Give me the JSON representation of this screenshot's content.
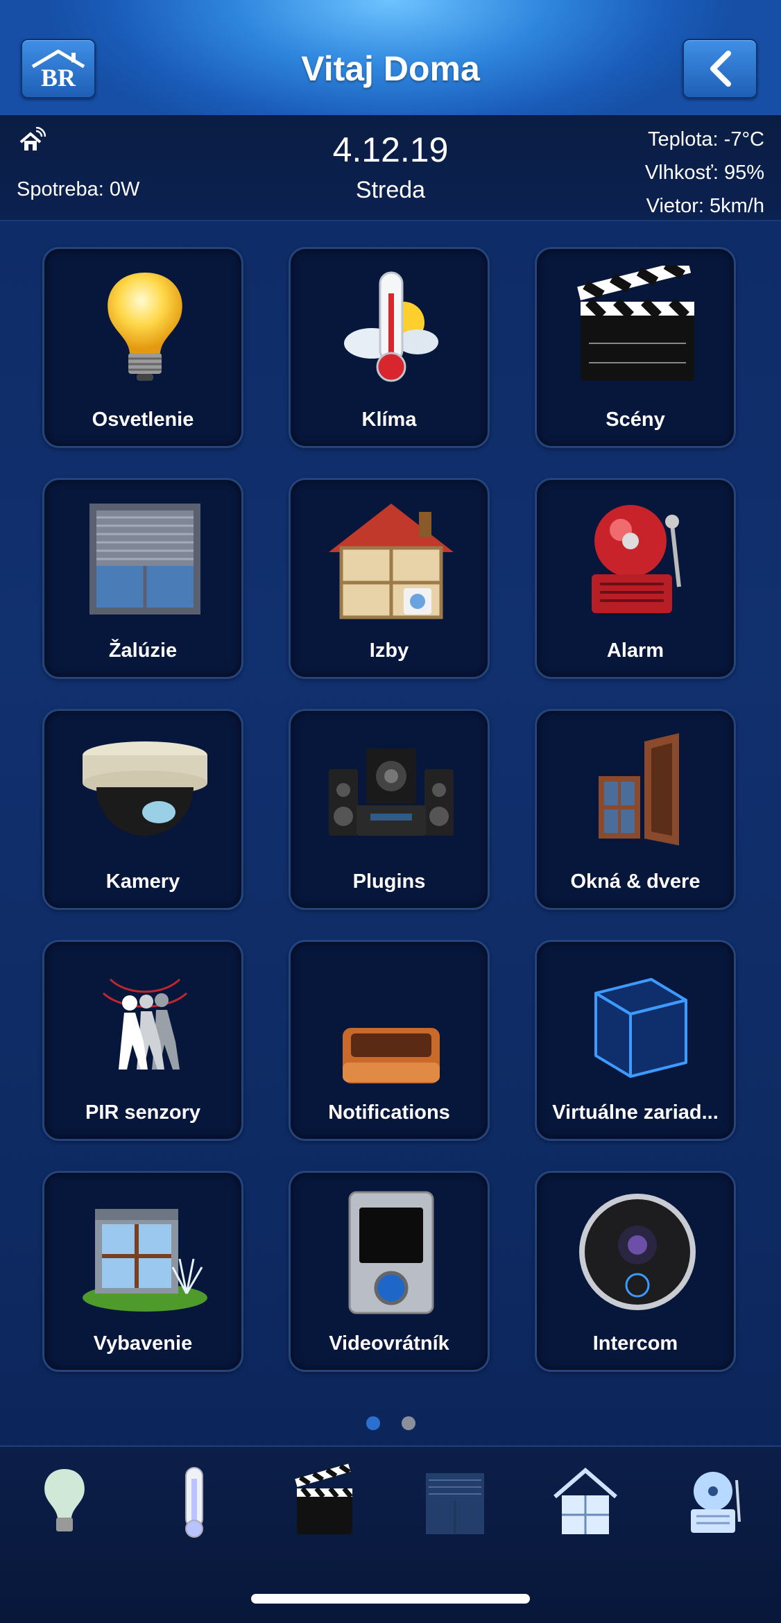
{
  "header": {
    "title": "Vitaj Doma",
    "logo_text": "BR"
  },
  "info": {
    "spotreba": "Spotreba: 0W",
    "date": "4.12.19",
    "day": "Streda",
    "teplota": "Teplota: -7°C",
    "vlhkost": "Vlhkosť: 95%",
    "vietor": "Vietor: 5km/h"
  },
  "tiles": [
    {
      "label": "Osvetlenie",
      "icon": "light-bulb-icon"
    },
    {
      "label": "Klíma",
      "icon": "thermometer-icon"
    },
    {
      "label": "Scény",
      "icon": "clapperboard-icon"
    },
    {
      "label": "Žalúzie",
      "icon": "roller-blind-icon"
    },
    {
      "label": "Izby",
      "icon": "house-rooms-icon"
    },
    {
      "label": "Alarm",
      "icon": "alarm-bell-icon"
    },
    {
      "label": "Kamery",
      "icon": "dome-camera-icon"
    },
    {
      "label": "Plugins",
      "icon": "stereo-icon"
    },
    {
      "label": "Okná & dvere",
      "icon": "window-door-icon"
    },
    {
      "label": "PIR senzory",
      "icon": "motion-sensor-icon"
    },
    {
      "label": "Notifications",
      "icon": "inbox-tray-icon"
    },
    {
      "label": "Virtuálne zariad...",
      "icon": "virtual-cube-icon"
    },
    {
      "label": "Vybavenie",
      "icon": "garden-window-icon"
    },
    {
      "label": "Videovrátník",
      "icon": "video-intercom-icon"
    },
    {
      "label": "Intercom",
      "icon": "intercom-camera-icon"
    }
  ],
  "pager": {
    "pages": 2,
    "current": 1
  },
  "tabbar": [
    {
      "icon": "light-bulb-icon"
    },
    {
      "icon": "thermometer-icon"
    },
    {
      "icon": "clapperboard-icon"
    },
    {
      "icon": "roller-blind-icon"
    },
    {
      "icon": "house-rooms-icon"
    },
    {
      "icon": "alarm-bell-icon"
    }
  ],
  "colors": {
    "accent": "#2f86dd",
    "tile_bg": "#07163b",
    "dot_active": "#2b6fd1",
    "dot_inactive": "#8a8f99"
  }
}
